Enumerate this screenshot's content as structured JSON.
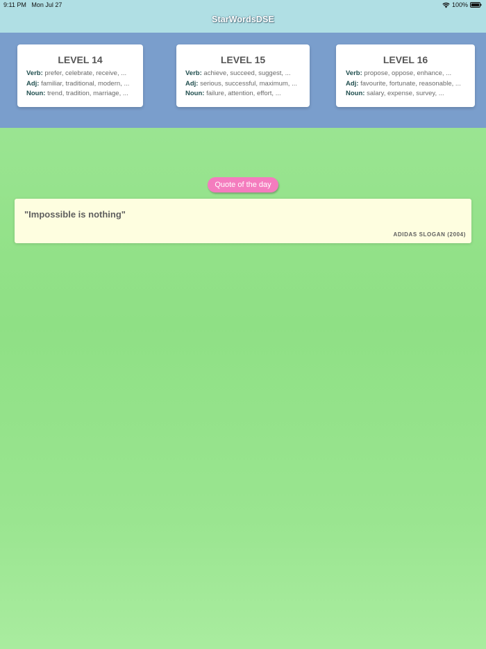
{
  "status_bar": {
    "time": "9:11 PM",
    "date": "Mon Jul 27",
    "battery": "100%",
    "wifi_icon": "wifi-icon",
    "battery_icon": "battery-icon"
  },
  "header": {
    "title": "StarWordsDSE"
  },
  "levels": [
    {
      "title": "LEVEL 14",
      "verb_label": "Verb:",
      "verb": "prefer, celebrate, receive, ...",
      "adj_label": "Adj:",
      "adj": "familiar, traditional, modern, ...",
      "noun_label": "Noun:",
      "noun": "trend, tradition, marriage, ..."
    },
    {
      "title": "LEVEL 15",
      "verb_label": "Verb:",
      "verb": "achieve, succeed, suggest, ...",
      "adj_label": "Adj:",
      "adj": "serious, successful, maximum, ...",
      "noun_label": "Noun:",
      "noun": "failure, attention, effort, ..."
    },
    {
      "title": "LEVEL 16",
      "verb_label": "Verb:",
      "verb": "propose, oppose, enhance, ...",
      "adj_label": "Adj:",
      "adj": "favourite, fortunate, reasonable, ...",
      "noun_label": "Noun:",
      "noun": "salary, expense, survey, ..."
    }
  ],
  "quote": {
    "button_label": "Quote of the day",
    "text": "\"Impossible is nothing\"",
    "author": "ADIDAS SLOGAN (2004)"
  },
  "colors": {
    "header_bg": "#b0dfe4",
    "levels_band_bg": "#7a9ecc",
    "quote_button": "#f47cbe",
    "quote_card_bg": "#fefee0",
    "background_green": "#92e188"
  }
}
